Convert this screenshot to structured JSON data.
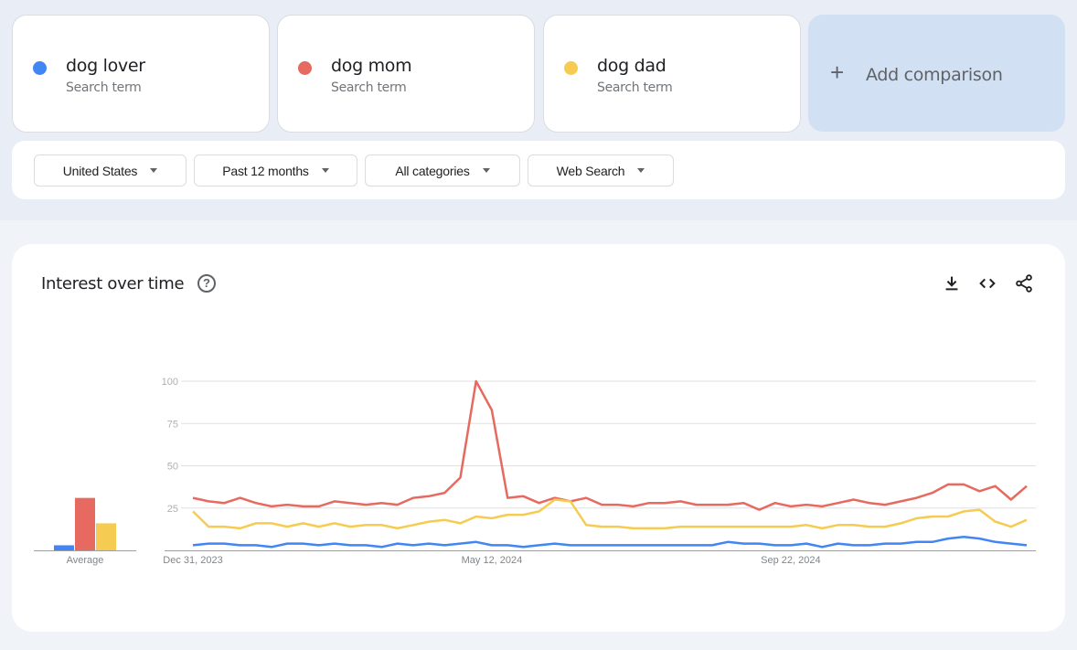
{
  "terms": [
    {
      "name": "dog lover",
      "sub": "Search term",
      "color": "#4285f4"
    },
    {
      "name": "dog mom",
      "sub": "Search term",
      "color": "#e66a60"
    },
    {
      "name": "dog dad",
      "sub": "Search term",
      "color": "#f6cb52"
    }
  ],
  "add_comparison": {
    "label": "Add comparison",
    "icon": "plus-icon"
  },
  "filters": [
    {
      "label": "United States"
    },
    {
      "label": "Past 12 months"
    },
    {
      "label": "All categories"
    },
    {
      "label": "Web Search"
    }
  ],
  "card": {
    "title": "Interest over time",
    "help_icon": "?",
    "actions": [
      "download-icon",
      "embed-code-icon",
      "share-icon"
    ]
  },
  "chart_data": {
    "type": "line",
    "title": "Interest over time",
    "xlabel": "",
    "ylabel": "",
    "ylim": [
      0,
      100
    ],
    "yticks": [
      25,
      50,
      75,
      100
    ],
    "grid": true,
    "x_tick_labels": [
      {
        "index": 0,
        "label": "Dec 31, 2023"
      },
      {
        "index": 19,
        "label": "May 12, 2024"
      },
      {
        "index": 38,
        "label": "Sep 22, 2024"
      }
    ],
    "n_points": 54,
    "series": [
      {
        "name": "dog lover",
        "color": "#4285f4",
        "values": [
          3,
          4,
          4,
          3,
          3,
          2,
          4,
          4,
          3,
          4,
          3,
          3,
          2,
          4,
          3,
          4,
          3,
          4,
          5,
          3,
          3,
          2,
          3,
          4,
          3,
          3,
          3,
          3,
          3,
          3,
          3,
          3,
          3,
          3,
          5,
          4,
          4,
          3,
          3,
          4,
          2,
          4,
          3,
          3,
          4,
          4,
          5,
          5,
          7,
          8,
          7,
          5,
          4,
          3
        ]
      },
      {
        "name": "dog mom",
        "color": "#e66a60",
        "values": [
          31,
          29,
          28,
          31,
          28,
          26,
          27,
          26,
          26,
          29,
          28,
          27,
          28,
          27,
          31,
          32,
          34,
          43,
          100,
          83,
          31,
          32,
          28,
          31,
          29,
          31,
          27,
          27,
          26,
          28,
          28,
          29,
          27,
          27,
          27,
          28,
          24,
          28,
          26,
          27,
          26,
          28,
          30,
          28,
          27,
          29,
          31,
          34,
          39,
          39,
          35,
          38,
          30,
          38
        ]
      },
      {
        "name": "dog dad",
        "color": "#f6cb52",
        "values": [
          23,
          14,
          14,
          13,
          16,
          16,
          14,
          16,
          14,
          16,
          14,
          15,
          15,
          13,
          15,
          17,
          18,
          16,
          20,
          19,
          21,
          21,
          23,
          30,
          29,
          15,
          14,
          14,
          13,
          13,
          13,
          14,
          14,
          14,
          14,
          14,
          14,
          14,
          14,
          15,
          13,
          15,
          15,
          14,
          14,
          16,
          19,
          20,
          20,
          23,
          24,
          17,
          14,
          18
        ]
      }
    ],
    "averages": {
      "label": "Average",
      "values": [
        {
          "name": "dog lover",
          "value": 3,
          "color": "#4285f4"
        },
        {
          "name": "dog mom",
          "value": 31,
          "color": "#e66a60"
        },
        {
          "name": "dog dad",
          "value": 16,
          "color": "#f6cb52"
        }
      ]
    }
  }
}
